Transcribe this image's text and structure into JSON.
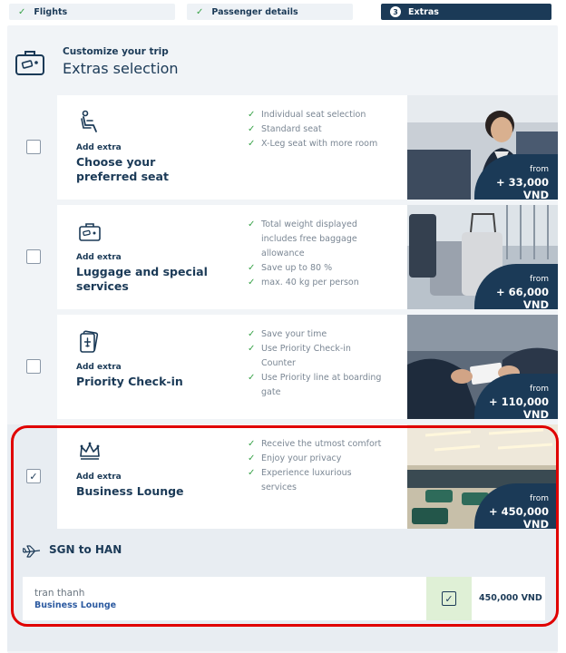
{
  "colors": {
    "brand": "#1b3a57",
    "check": "#3aa34a",
    "highlight": "#e00000"
  },
  "stepper": [
    {
      "label": "Flights",
      "state": "done",
      "icon": "check-icon"
    },
    {
      "label": "Passenger details",
      "state": "done",
      "icon": "check-icon"
    },
    {
      "number": "3",
      "label": "Extras",
      "state": "active"
    }
  ],
  "header": {
    "subtitle": "Customize your trip",
    "title": "Extras selection",
    "icon": "suitcase-icon"
  },
  "extras": [
    {
      "icon": "seat-icon",
      "checked": false,
      "add_label": "Add extra",
      "title": "Choose your preferred seat",
      "features": [
        "Individual seat selection",
        "Standard seat",
        "X-Leg seat with more room"
      ],
      "price_from": "from",
      "price": "+ 33,000 VND"
    },
    {
      "icon": "luggage-icon",
      "checked": false,
      "add_label": "Add extra",
      "title": "Luggage and special services",
      "features": [
        "Total weight displayed includes free baggage allowance",
        "Save up to 80 %",
        "max. 40 kg per person"
      ],
      "price_from": "from",
      "price": "+ 66,000 VND"
    },
    {
      "icon": "boarding-pass-icon",
      "checked": false,
      "add_label": "Add extra",
      "title": "Priority Check-in",
      "features": [
        "Save your time",
        "Use Priority Check-in Counter",
        "Use Priority line at boarding gate"
      ],
      "price_from": "from",
      "price": "+ 110,000 VND"
    },
    {
      "icon": "crown-icon",
      "checked": true,
      "add_label": "Add extra",
      "title": "Business Lounge",
      "features": [
        "Receive the utmost comfort",
        "Enjoy your privacy",
        "Experience luxurious services"
      ],
      "price_from": "from",
      "price": "+ 450,000 VND"
    }
  ],
  "lounge": {
    "route": "SGN to HAN",
    "passenger": {
      "name": "tran thanh",
      "service": "Business Lounge",
      "checked": true,
      "price": "450,000 VND"
    }
  }
}
